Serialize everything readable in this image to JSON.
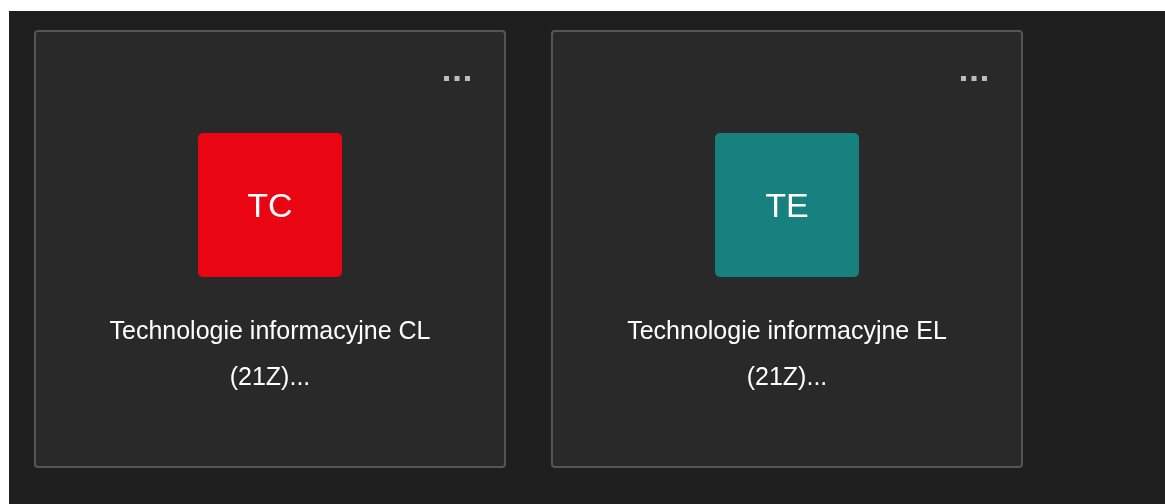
{
  "teams": [
    {
      "initials": "TC",
      "color": "#ea0513",
      "name": "Technologie informacyjne CL (21Z)..."
    },
    {
      "initials": "TE",
      "color": "#178180",
      "name": "Technologie informacyjne EL (21Z)..."
    }
  ]
}
